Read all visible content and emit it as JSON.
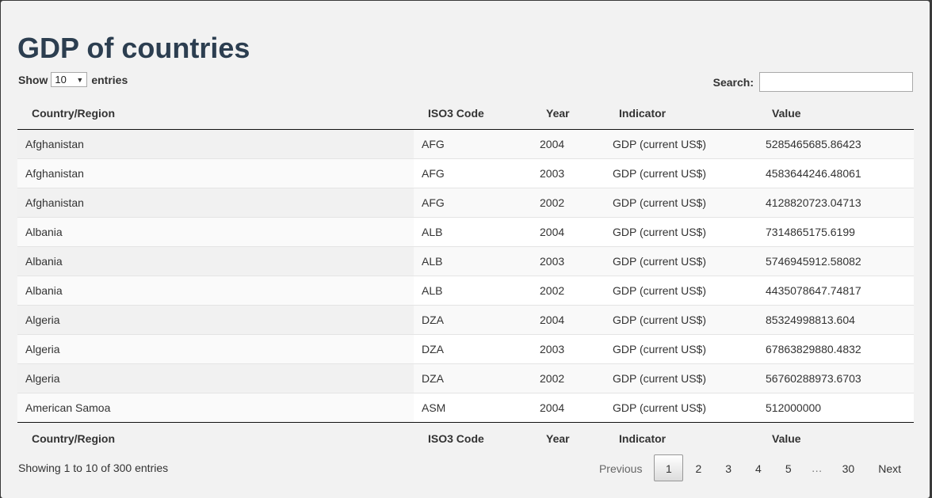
{
  "title": "GDP of countries",
  "length": {
    "show_label": "Show",
    "value": "10",
    "entries_label": "entries"
  },
  "search": {
    "label": "Search:",
    "value": ""
  },
  "columns": [
    "Country/Region",
    "ISO3 Code",
    "Year",
    "Indicator",
    "Value"
  ],
  "rows": [
    [
      "Afghanistan",
      "AFG",
      "2004",
      "GDP (current US$)",
      "5285465685.86423"
    ],
    [
      "Afghanistan",
      "AFG",
      "2003",
      "GDP (current US$)",
      "4583644246.48061"
    ],
    [
      "Afghanistan",
      "AFG",
      "2002",
      "GDP (current US$)",
      "4128820723.04713"
    ],
    [
      "Albania",
      "ALB",
      "2004",
      "GDP (current US$)",
      "7314865175.6199"
    ],
    [
      "Albania",
      "ALB",
      "2003",
      "GDP (current US$)",
      "5746945912.58082"
    ],
    [
      "Albania",
      "ALB",
      "2002",
      "GDP (current US$)",
      "4435078647.74817"
    ],
    [
      "Algeria",
      "DZA",
      "2004",
      "GDP (current US$)",
      "85324998813.604"
    ],
    [
      "Algeria",
      "DZA",
      "2003",
      "GDP (current US$)",
      "67863829880.4832"
    ],
    [
      "Algeria",
      "DZA",
      "2002",
      "GDP (current US$)",
      "56760288973.6703"
    ],
    [
      "American Samoa",
      "ASM",
      "2004",
      "GDP (current US$)",
      "512000000"
    ]
  ],
  "info": "Showing 1 to 10 of 300 entries",
  "pagination": {
    "previous": "Previous",
    "pages": [
      "1",
      "2",
      "3",
      "4",
      "5"
    ],
    "ellipsis": "…",
    "last": "30",
    "next": "Next",
    "current": "1"
  }
}
